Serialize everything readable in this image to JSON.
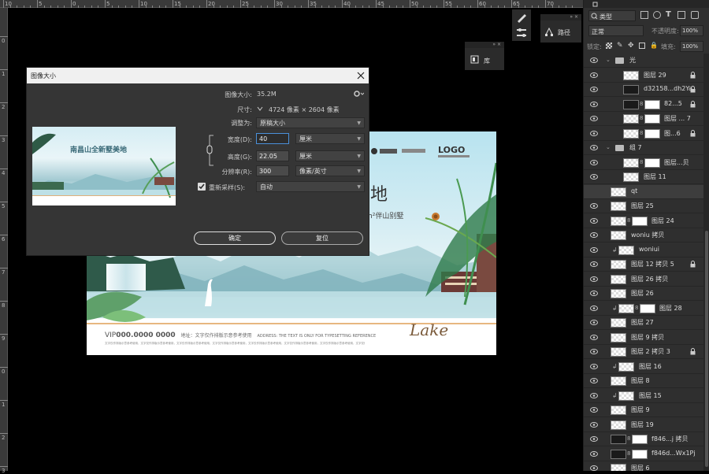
{
  "ruler": {
    "top_numbers": [
      "10",
      "5",
      "0",
      "5",
      "10",
      "15",
      "20",
      "25",
      "30",
      "35",
      "40",
      "45",
      "50",
      "55",
      "60",
      "65",
      "70"
    ],
    "left_numbers": [
      "0",
      "1",
      "2",
      "3",
      "4",
      "5",
      "6",
      "7",
      "8",
      "9",
      "0",
      "1",
      "2",
      "3"
    ]
  },
  "floating_panels": {
    "paths_label": "路径",
    "library_label": "库"
  },
  "layers_panel": {
    "kind_filter": "类型",
    "blend_mode": "正常",
    "opacity_label": "不透明度:",
    "opacity_value": "100%",
    "lock_label": "锁定:",
    "fill_label": "填充:",
    "fill_value": "100%",
    "layers": [
      {
        "name": "光",
        "type": "group"
      },
      {
        "name": "图层 29",
        "locked": true
      },
      {
        "name": "d32158...dh2Ya",
        "locked": true
      },
      {
        "name": "82...5",
        "locked": true
      },
      {
        "name": "图层 ... 7"
      },
      {
        "name": "图...6",
        "locked": true
      },
      {
        "name": "组 7",
        "type": "group"
      },
      {
        "name": "图层...贝"
      },
      {
        "name": "图层 11"
      },
      {
        "name": "qt"
      },
      {
        "name": "图层 25"
      },
      {
        "name": "图层 24"
      },
      {
        "name": "woniu 拷贝"
      },
      {
        "name": "woniui"
      },
      {
        "name": "图层 12 拷贝 5",
        "locked": true
      },
      {
        "name": "图层 26 拷贝"
      },
      {
        "name": "图层 26"
      },
      {
        "name": "图层 28"
      },
      {
        "name": "图层 27"
      },
      {
        "name": "图层 9 拷贝"
      },
      {
        "name": "图层 2 拷贝 3",
        "locked": true
      },
      {
        "name": "图层 16"
      },
      {
        "name": "图层 8"
      },
      {
        "name": "图层 15"
      },
      {
        "name": "图层 9"
      },
      {
        "name": "图层 19"
      },
      {
        "name": "f846...j 拷贝"
      },
      {
        "name": "f846d...Wx1Pj"
      },
      {
        "name": "图层 6"
      }
    ]
  },
  "canvas": {
    "logo": "LOGO",
    "headline_fragment": "地",
    "sub_fragment": "m²伴山别墅",
    "vip_text": "VIP",
    "vip_phone": "000.0000 0000",
    "address_label": "地址：",
    "address_cn": "文字仅作排版示意参考使用",
    "address_en": "ADDRESS: THE TEXT IS ONLY FOR TYPESETTING REFERENCE",
    "fine_print": "文字仅作排版示意参考使用，文字仅作排版示意参考使用，文字仅作排版示意参考使用，文字仅作排版示意参考使用，文字仅作排版示意参考使用，文字仅作排版示意参考使用，文字仅作排版示意参考使用，文字仅作排版示意参考使用",
    "signature": "Lake"
  },
  "dialog": {
    "title": "图像大小",
    "preview_headline": "南昌山全新墅美地",
    "image_size_label": "图像大小:",
    "image_size_value": "35.2M",
    "dimensions_label": "尺寸:",
    "dimensions_value": "4724 像素 × 2604 像素",
    "fit_to_label": "调整为:",
    "fit_to_value": "原稿大小",
    "width_label": "宽度(D):",
    "width_value": "40",
    "width_unit": "厘米",
    "height_label": "高度(G):",
    "height_value": "22.05",
    "height_unit": "厘米",
    "resolution_label": "分辨率(R):",
    "resolution_value": "300",
    "resolution_unit": "像素/英寸",
    "resample_label": "重新采样(S):",
    "resample_value": "自动",
    "resample_checked": true,
    "ok_label": "确定",
    "reset_label": "复位"
  }
}
